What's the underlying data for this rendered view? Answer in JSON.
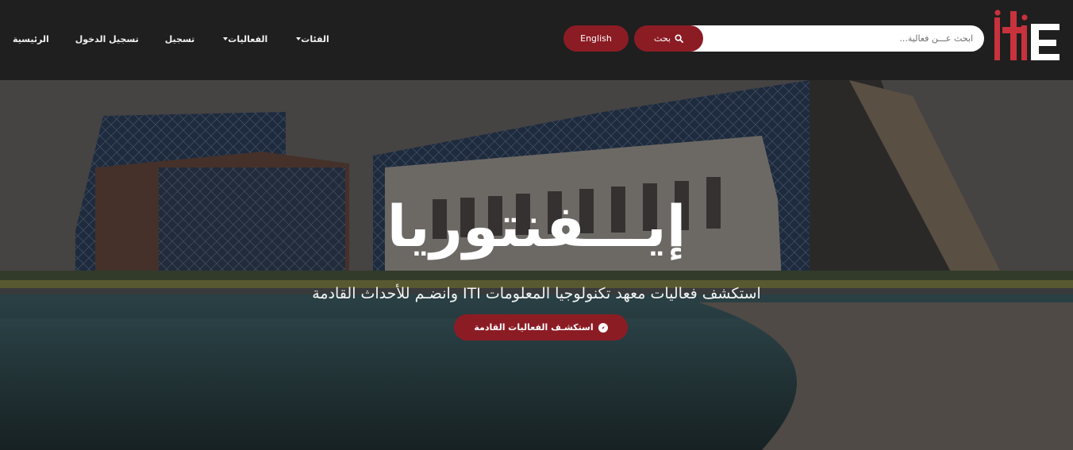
{
  "nav": {
    "items": [
      {
        "label": "الرئيسية",
        "dropdown": false
      },
      {
        "label": "تسجيل الدخول",
        "dropdown": false
      },
      {
        "label": "تسجيل",
        "dropdown": false
      },
      {
        "label": "الفعاليات",
        "dropdown": true
      },
      {
        "label": "الفئات",
        "dropdown": true
      }
    ]
  },
  "header": {
    "language_button": "English",
    "search": {
      "placeholder": "ابحث عـــن فعالية...",
      "button_label": "بحث",
      "icon": "search-icon"
    },
    "logo": {
      "text": "iti",
      "icon": "iti-logo"
    }
  },
  "hero": {
    "title_main": "إيـــفنتوريا",
    "subtitle": "استكشف فعاليات معهد تكنولوجيا المعلومات ITI وانضـم للأحداث القادمة",
    "cta_label": "استكشـف الفعاليات القادمة",
    "cta_icon": "compass-icon",
    "background": "iti-building-photo"
  },
  "colors": {
    "primary": "#8c1c24",
    "navbar_bg": "#1f1f1f",
    "accent_purple": "#8b2f9a",
    "logo_red": "#c8323c"
  }
}
